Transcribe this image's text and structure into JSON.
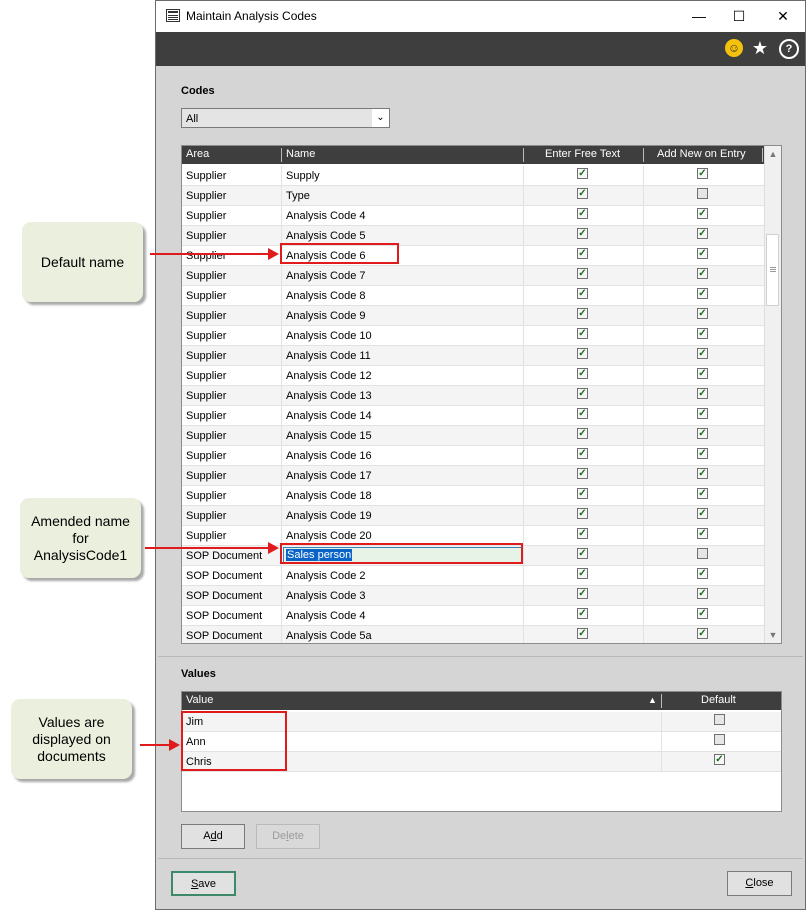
{
  "window": {
    "title": "Maintain Analysis Codes",
    "controls": {
      "minimize": "—",
      "maximize": "☐",
      "close": "✕"
    }
  },
  "toolbar": {
    "icons": [
      "smiley-icon",
      "star-icon",
      "help-icon"
    ],
    "smile_glyph": "☺",
    "star_glyph": "★",
    "help_glyph": "?"
  },
  "codes": {
    "label": "Codes",
    "filter": {
      "selected": "All",
      "arrow": "⌄"
    },
    "columns": [
      "Area",
      "Name",
      "Enter Free Text",
      "Add New on Entry"
    ],
    "rows": [
      {
        "area": "Supplier",
        "name": "Supply",
        "free_text": true,
        "add_new": true
      },
      {
        "area": "Supplier",
        "name": "Type",
        "free_text": true,
        "add_new": false
      },
      {
        "area": "Supplier",
        "name": "Analysis Code 4",
        "free_text": true,
        "add_new": true
      },
      {
        "area": "Supplier",
        "name": "Analysis Code 5",
        "free_text": true,
        "add_new": true
      },
      {
        "area": "Supplier",
        "name": "Analysis Code 6",
        "free_text": true,
        "add_new": true
      },
      {
        "area": "Supplier",
        "name": "Analysis Code 7",
        "free_text": true,
        "add_new": true
      },
      {
        "area": "Supplier",
        "name": "Analysis Code 8",
        "free_text": true,
        "add_new": true
      },
      {
        "area": "Supplier",
        "name": "Analysis Code 9",
        "free_text": true,
        "add_new": true
      },
      {
        "area": "Supplier",
        "name": "Analysis Code 10",
        "free_text": true,
        "add_new": true
      },
      {
        "area": "Supplier",
        "name": "Analysis Code 11",
        "free_text": true,
        "add_new": true
      },
      {
        "area": "Supplier",
        "name": "Analysis Code 12",
        "free_text": true,
        "add_new": true
      },
      {
        "area": "Supplier",
        "name": "Analysis Code 13",
        "free_text": true,
        "add_new": true
      },
      {
        "area": "Supplier",
        "name": "Analysis Code 14",
        "free_text": true,
        "add_new": true
      },
      {
        "area": "Supplier",
        "name": "Analysis Code 15",
        "free_text": true,
        "add_new": true
      },
      {
        "area": "Supplier",
        "name": "Analysis Code 16",
        "free_text": true,
        "add_new": true
      },
      {
        "area": "Supplier",
        "name": "Analysis Code 17",
        "free_text": true,
        "add_new": true
      },
      {
        "area": "Supplier",
        "name": "Analysis Code 18",
        "free_text": true,
        "add_new": true
      },
      {
        "area": "Supplier",
        "name": "Analysis Code 19",
        "free_text": true,
        "add_new": true
      },
      {
        "area": "Supplier",
        "name": "Analysis Code 20",
        "free_text": true,
        "add_new": true
      },
      {
        "area": "SOP Document",
        "name": "Sales person",
        "free_text": true,
        "add_new": false,
        "editing": true
      },
      {
        "area": "SOP Document",
        "name": "Analysis Code 2",
        "free_text": true,
        "add_new": true
      },
      {
        "area": "SOP Document",
        "name": "Analysis Code 3",
        "free_text": true,
        "add_new": true
      },
      {
        "area": "SOP Document",
        "name": "Analysis Code 4",
        "free_text": true,
        "add_new": true
      },
      {
        "area": "SOP Document",
        "name": "Analysis Code 5a",
        "free_text": true,
        "add_new": true
      }
    ]
  },
  "values": {
    "label": "Values",
    "columns": [
      "Value",
      "Default"
    ],
    "sort_glyph": "▲",
    "rows": [
      {
        "value": "Jim",
        "default": false
      },
      {
        "value": "Ann",
        "default": false
      },
      {
        "value": "Chris",
        "default": true
      }
    ],
    "add_label": "Add",
    "delete_label": "Delete"
  },
  "footer": {
    "save_label": "Save",
    "close_label": "Close"
  },
  "callouts": {
    "default_name": "Default name",
    "amended_name": "Amended name for AnalysisCode1",
    "values_note": "Values are displayed on documents"
  },
  "check_glyph": "✓",
  "colors": {
    "annotation_red": "#e01b1b",
    "callout_bg": "#ebefdd",
    "header_bg": "#3e3e3e",
    "selection_blue": "#0a64c8"
  }
}
